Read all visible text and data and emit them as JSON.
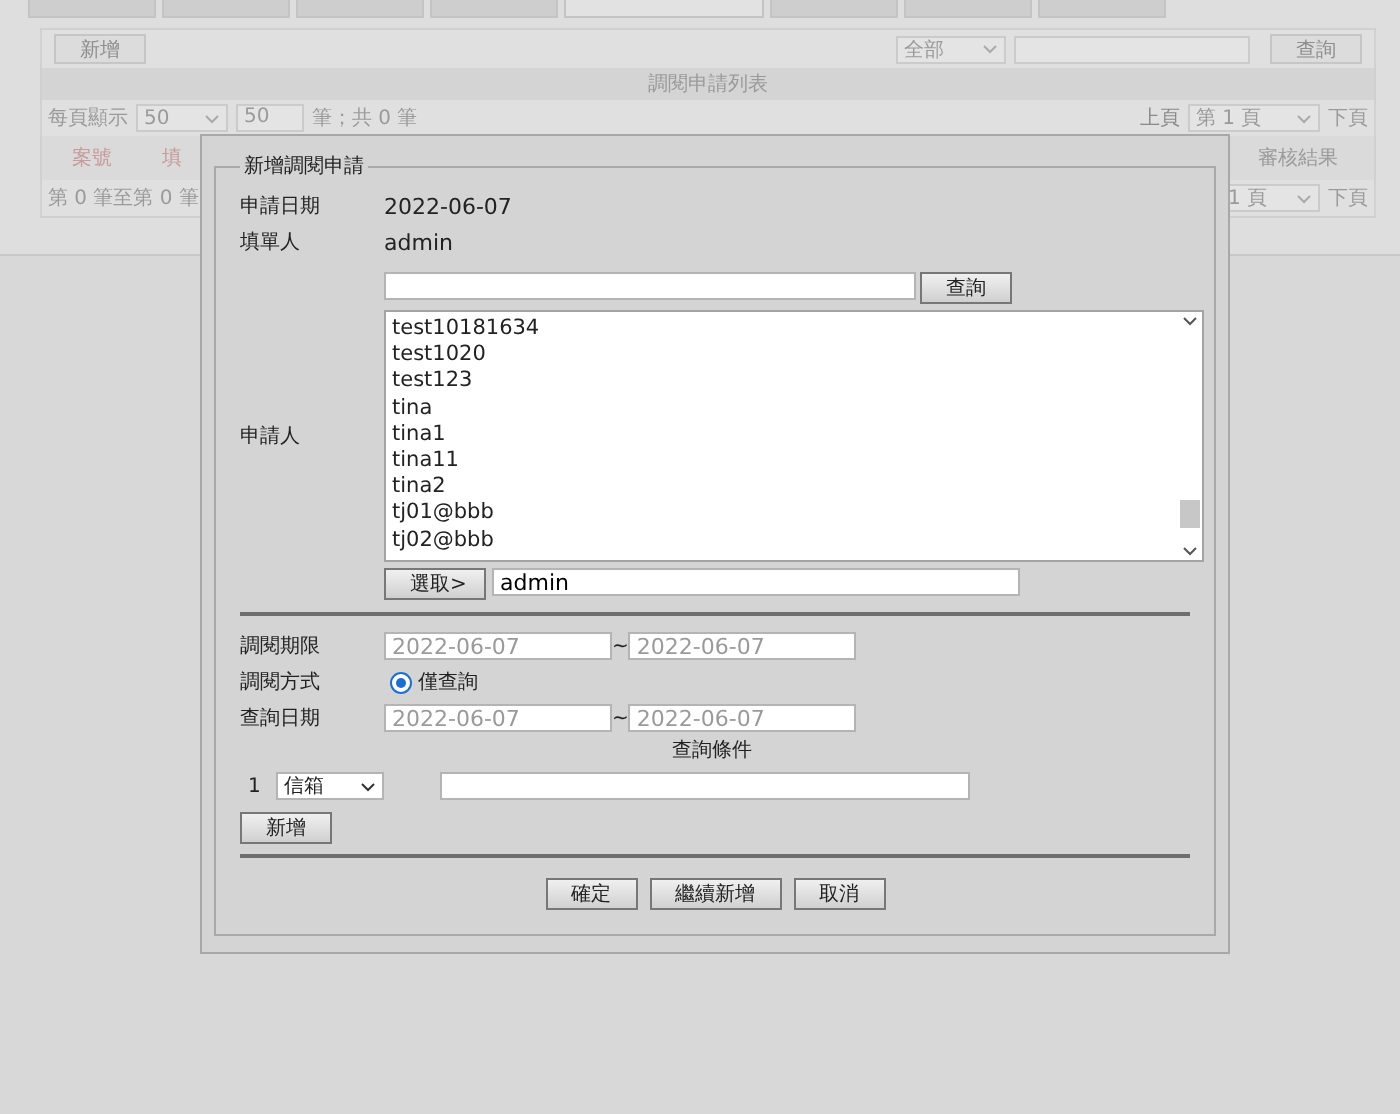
{
  "tabs": [
    {
      "selected": false
    },
    {
      "selected": false
    },
    {
      "selected": false
    },
    {
      "selected": false
    },
    {
      "selected": true
    },
    {
      "selected": false
    },
    {
      "selected": false
    },
    {
      "selected": false
    }
  ],
  "toolbar": {
    "add_button": "新增",
    "filter": "全部",
    "search_button": "查詢"
  },
  "list_title": "調閱申請列表",
  "pager_top": {
    "per_page_label": "每頁顯示",
    "per_page": "50",
    "page_size": "50",
    "count": "筆；共 0 筆",
    "prev": "上頁",
    "page": "第 1 頁",
    "next": "下頁"
  },
  "columns": [
    "案號",
    "填",
    "審核結果"
  ],
  "pager_bottom": {
    "range": "第 0 筆至第 0 筆",
    "page": "1 頁",
    "next": "下頁"
  },
  "dialog": {
    "legend": "新增調閱申請",
    "apply_date": {
      "label": "申請日期",
      "value": "2022-06-07"
    },
    "filler": {
      "label": "填單人",
      "value": "admin"
    },
    "applicant": {
      "label": "申請人",
      "search_button": "查詢",
      "users": [
        "test10181634",
        "test1020",
        "test123",
        "tina",
        "tina1",
        "tina11",
        "tina2",
        "tj01@bbb",
        "tj02@bbb"
      ],
      "pick_button": "選取>",
      "picked": "admin"
    },
    "period": {
      "label": "調閱期限",
      "from": "2022-06-07",
      "sep": "~",
      "to": "2022-06-07"
    },
    "method": {
      "label": "調閱方式",
      "options": [
        {
          "label": "僅查詢",
          "selected": true
        }
      ]
    },
    "query_date": {
      "label": "查詢日期",
      "from": "2022-06-07",
      "sep": "~",
      "to": "2022-06-07"
    },
    "conditions_title": "查詢條件",
    "conditions": [
      {
        "index": "1",
        "field": "信箱"
      }
    ],
    "add_button": "新增",
    "buttons": [
      "確定",
      "繼續新增",
      "取消"
    ]
  }
}
